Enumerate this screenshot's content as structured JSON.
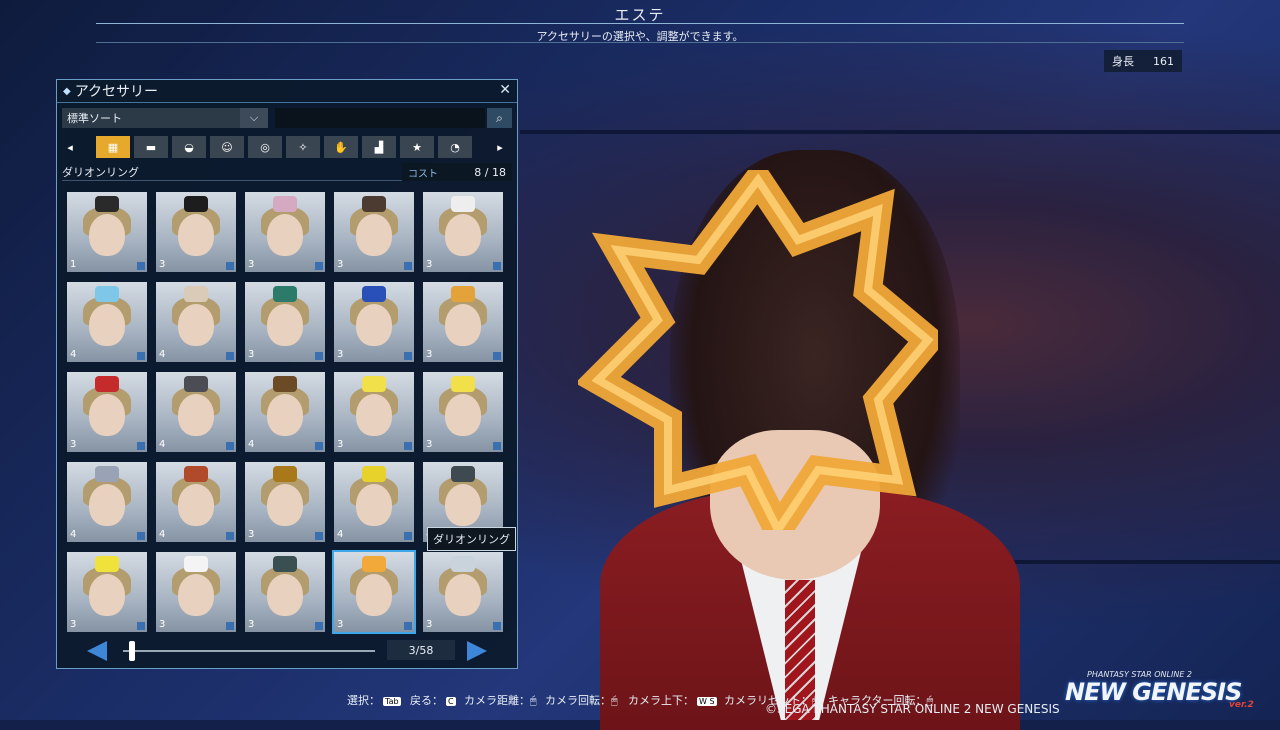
{
  "screen": {
    "title": "エステ",
    "subtitle": "アクセサリーの選択や、調整ができます。",
    "height_label": "身長",
    "height_value": "161"
  },
  "panel": {
    "title": "アクセサリー",
    "sort_value": "標準ソート",
    "search_placeholder": "",
    "categories": [
      "all",
      "rect",
      "helmet",
      "face",
      "ring",
      "wing",
      "hand",
      "stair",
      "star",
      "pie"
    ],
    "selected_name": "ダリオンリング",
    "cost_label": "コスト",
    "cost_value": "8 /  18",
    "page": "3/58",
    "items": [
      {
        "level": "1",
        "accent": "#2a2a2a"
      },
      {
        "level": "3",
        "accent": "#1d1d1d"
      },
      {
        "level": "3",
        "accent": "#d6a9c2"
      },
      {
        "level": "3",
        "accent": "#4b3b30"
      },
      {
        "level": "3",
        "accent": "#eeeeee"
      },
      {
        "level": "4",
        "accent": "#7fc7e8"
      },
      {
        "level": "4",
        "accent": "#d9cbb8"
      },
      {
        "level": "3",
        "accent": "#2c7a6a"
      },
      {
        "level": "3",
        "accent": "#2850b8"
      },
      {
        "level": "3",
        "accent": "#e3a23a"
      },
      {
        "level": "3",
        "accent": "#c62b2b"
      },
      {
        "level": "4",
        "accent": "#4c4c54"
      },
      {
        "level": "4",
        "accent": "#6b4a26"
      },
      {
        "level": "3",
        "accent": "#f2e04a"
      },
      {
        "level": "3",
        "accent": "#f2e04a"
      },
      {
        "level": "4",
        "accent": "#9aa3b5"
      },
      {
        "level": "4",
        "accent": "#b04a2a"
      },
      {
        "level": "3",
        "accent": "#a8781a"
      },
      {
        "level": "4",
        "accent": "#e7d22c"
      },
      {
        "level": "4",
        "accent": "#3e4a50"
      },
      {
        "level": "3",
        "accent": "#f0e23a"
      },
      {
        "level": "3",
        "accent": "#f4f4f4"
      },
      {
        "level": "3",
        "accent": "#3a4f52"
      },
      {
        "level": "3",
        "accent": "#f2a93a"
      },
      {
        "level": "3",
        "accent": "#c8d3dc"
      }
    ]
  },
  "tooltip": "ダリオンリング",
  "hints": {
    "select": "選択：",
    "back": "戻る：",
    "camera_distance": "カメラ距離：",
    "camera_rotate": "カメラ回転：",
    "camera_updown": "カメラ上下：",
    "camera_reset": "カメラリセット：",
    "char_rotate": "キャラクター回転：",
    "key_tab": "Tab",
    "key_c": "C",
    "key_ws": "W S"
  },
  "copyright": "©SEGA PHANTASY STAR ONLINE 2 NEW GENESIS",
  "logo": {
    "top": "PHANTASY STAR ONLINE 2",
    "main": "NEW GENESIS",
    "ver": "ver.2"
  }
}
